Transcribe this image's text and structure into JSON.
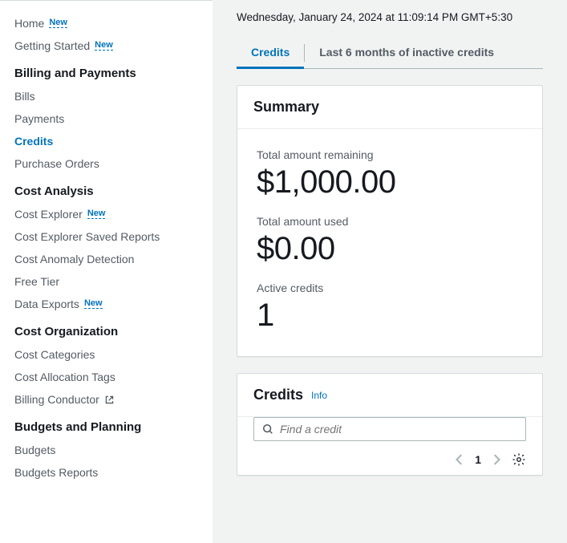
{
  "sidebar": {
    "home": "Home",
    "getting_started": "Getting Started",
    "new_badge": "New",
    "section_billing": "Billing and Payments",
    "bills": "Bills",
    "payments": "Payments",
    "credits": "Credits",
    "purchase_orders": "Purchase Orders",
    "section_cost_analysis": "Cost Analysis",
    "cost_explorer": "Cost Explorer",
    "cost_explorer_saved": "Cost Explorer Saved Reports",
    "cost_anomaly": "Cost Anomaly Detection",
    "free_tier": "Free Tier",
    "data_exports": "Data Exports",
    "section_cost_org": "Cost Organization",
    "cost_categories": "Cost Categories",
    "cost_allocation_tags": "Cost Allocation Tags",
    "billing_conductor": "Billing Conductor",
    "section_budgets": "Budgets and Planning",
    "budgets": "Budgets",
    "budgets_reports": "Budgets Reports"
  },
  "main": {
    "timestamp": "Wednesday, January 24, 2024 at 11:09:14 PM GMT+5:30",
    "tabs": {
      "credits": "Credits",
      "inactive": "Last 6 months of inactive credits"
    },
    "summary": {
      "title": "Summary",
      "remaining_label": "Total amount remaining",
      "remaining_value": "$1,000.00",
      "used_label": "Total amount used",
      "used_value": "$0.00",
      "active_label": "Active credits",
      "active_value": "1"
    },
    "credits_panel": {
      "title": "Credits",
      "info": "Info",
      "search_placeholder": "Find a credit",
      "page": "1"
    }
  }
}
